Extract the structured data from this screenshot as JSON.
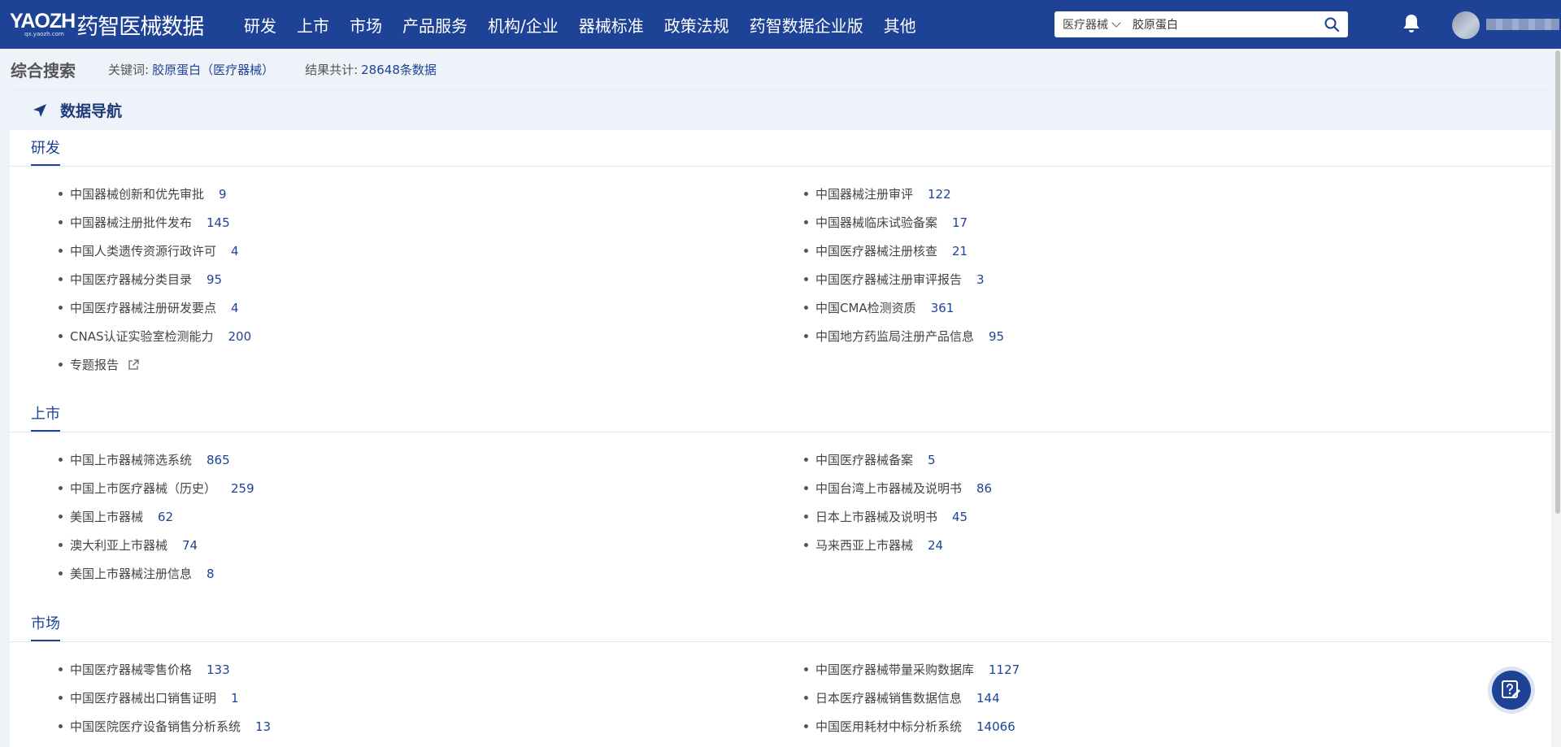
{
  "header": {
    "logo_en": "yaozh",
    "logo_url": "qx.yaozh.com",
    "logo_cn": "药智医械数据",
    "nav": [
      "研发",
      "上市",
      "市场",
      "产品服务",
      "机构/企业",
      "器械标准",
      "政策法规",
      "药智数据企业版",
      "其他"
    ],
    "search": {
      "category": "医疗器械",
      "value": "胶原蛋白"
    }
  },
  "subhead": {
    "title": "综合搜索",
    "keyword_label": "关键词:",
    "keyword_value": "胶原蛋白（医疗器械）",
    "total_label": "结果共计:",
    "total_value": "28648条数据"
  },
  "panel": {
    "title": "数据导航",
    "sections": [
      {
        "name": "研发",
        "items": [
          {
            "label": "中国器械创新和优先审批",
            "count": "9"
          },
          {
            "label": "中国器械注册审评",
            "count": "122"
          },
          {
            "label": "中国器械注册批件发布",
            "count": "145"
          },
          {
            "label": "中国器械临床试验备案",
            "count": "17"
          },
          {
            "label": "中国人类遗传资源行政许可",
            "count": "4"
          },
          {
            "label": "中国医疗器械注册核查",
            "count": "21"
          },
          {
            "label": "中国医疗器械分类目录",
            "count": "95"
          },
          {
            "label": "中国医疗器械注册审评报告",
            "count": "3"
          },
          {
            "label": "中国医疗器械注册研发要点",
            "count": "4"
          },
          {
            "label": "中国CMA检测资质",
            "count": "361"
          },
          {
            "label": "CNAS认证实验室检测能力",
            "count": "200"
          },
          {
            "label": "中国地方药监局注册产品信息",
            "count": "95"
          },
          {
            "label": "专题报告",
            "count": ""
          }
        ]
      },
      {
        "name": "上市",
        "items": [
          {
            "label": "中国上市器械筛选系统",
            "count": "865"
          },
          {
            "label": "中国医疗器械备案",
            "count": "5"
          },
          {
            "label": "中国上市医疗器械（历史）",
            "count": "259"
          },
          {
            "label": "中国台湾上市器械及说明书",
            "count": "86"
          },
          {
            "label": "美国上市器械",
            "count": "62"
          },
          {
            "label": "日本上市器械及说明书",
            "count": "45"
          },
          {
            "label": "澳大利亚上市器械",
            "count": "74"
          },
          {
            "label": "马来西亚上市器械",
            "count": "24"
          },
          {
            "label": "美国上市器械注册信息",
            "count": "8"
          }
        ]
      },
      {
        "name": "市场",
        "items": [
          {
            "label": "中国医疗器械零售价格",
            "count": "133"
          },
          {
            "label": "中国医疗器械带量采购数据库",
            "count": "1127"
          },
          {
            "label": "中国医疗器械出口销售证明",
            "count": "1"
          },
          {
            "label": "日本医疗器械销售数据信息",
            "count": "144"
          },
          {
            "label": "中国医院医疗设备销售分析系统",
            "count": "13"
          },
          {
            "label": "中国医用耗材中标分析系统",
            "count": "14066"
          }
        ]
      }
    ]
  },
  "icons": {
    "search": "search-icon",
    "bell": "bell-icon",
    "nav_arrow": "navigation-arrow-icon",
    "external": "external-link-icon",
    "help": "help-feedback-icon"
  },
  "colors": {
    "brand": "#1e4396",
    "page_bg": "#eef2f9",
    "count": "#1e4396"
  }
}
